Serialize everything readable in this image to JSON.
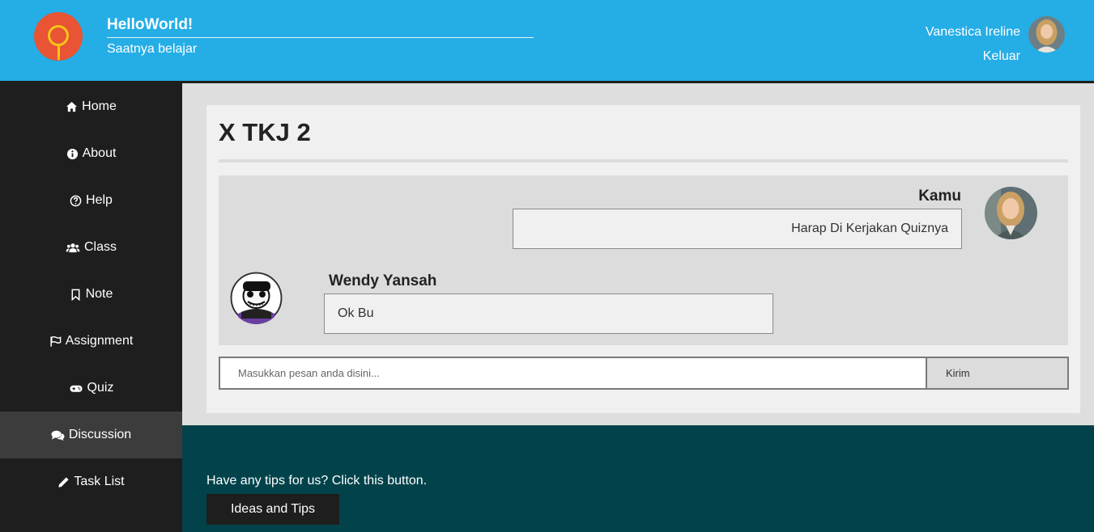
{
  "header": {
    "brand_title": "HelloWorld!",
    "brand_subtitle": "Saatnya belajar",
    "user_name": "Vanestica Ireline",
    "logout_label": "Keluar"
  },
  "sidebar": {
    "items": [
      {
        "label": "Home",
        "icon": "home-icon"
      },
      {
        "label": "About",
        "icon": "info-icon"
      },
      {
        "label": "Help",
        "icon": "question-circle-icon"
      },
      {
        "label": "Class",
        "icon": "users-icon"
      },
      {
        "label": "Note",
        "icon": "bookmark-icon"
      },
      {
        "label": "Assignment",
        "icon": "flag-icon"
      },
      {
        "label": "Quiz",
        "icon": "gamepad-icon"
      },
      {
        "label": "Discussion",
        "icon": "comments-icon",
        "active": true
      },
      {
        "label": "Task List",
        "icon": "pencil-icon"
      }
    ]
  },
  "main": {
    "title": "X TKJ 2",
    "messages": [
      {
        "sender": "Kamu",
        "text": "Harap Di Kerjakan Quiznya",
        "align": "right"
      },
      {
        "sender": "Wendy Yansah",
        "text": "Ok Bu",
        "align": "left"
      }
    ],
    "input_placeholder": "Masukkan pesan anda disini...",
    "send_label": "Kirim"
  },
  "footer": {
    "text": "Have any tips for us? Click this button.",
    "button_label": "Ideas and Tips"
  },
  "colors": {
    "header": "#25ade6",
    "sidebar": "#1e1e1e",
    "footer": "#02434b",
    "logo": "#e85434"
  }
}
